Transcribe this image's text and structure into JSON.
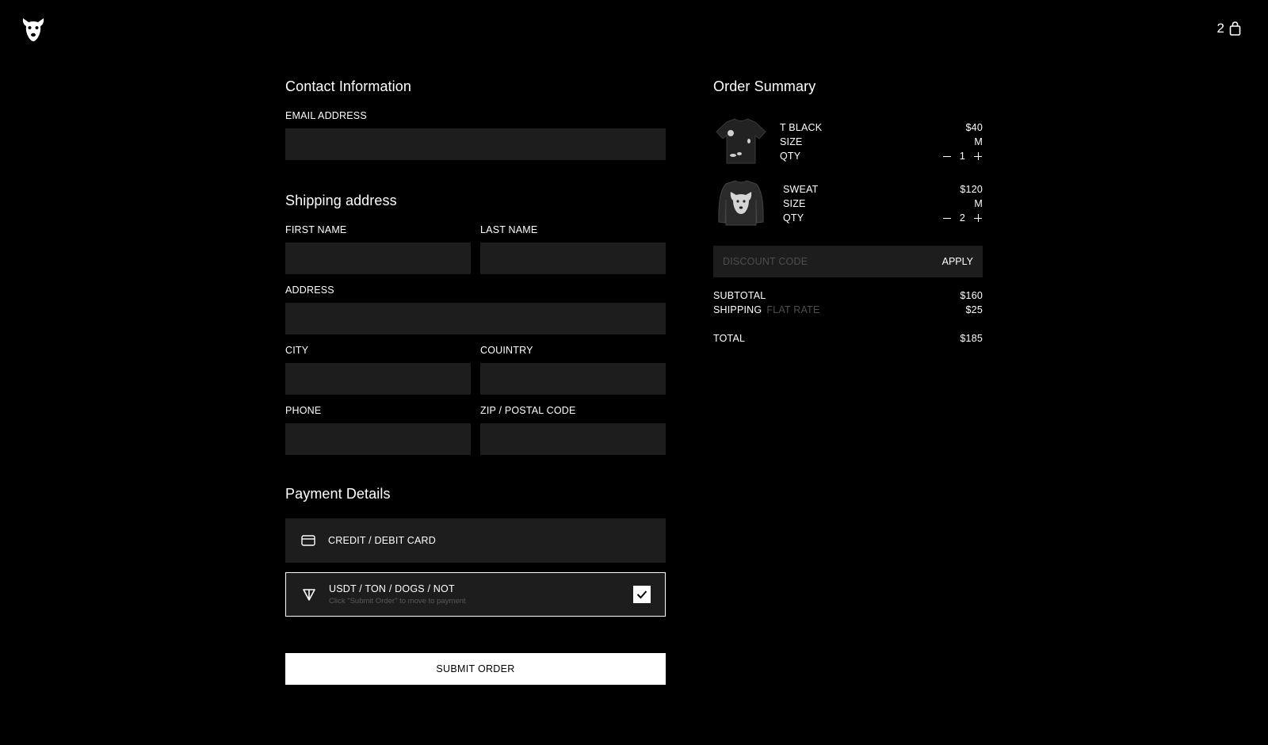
{
  "header": {
    "cart_count": "2"
  },
  "contact": {
    "title": "Contact Information",
    "email_label": "EMAIL ADDRESS"
  },
  "shipping": {
    "title": "Shipping address",
    "first_name_label": "FIRST NAME",
    "last_name_label": "LAST NAME",
    "address_label": "ADDRESS",
    "city_label": "CITY",
    "country_label": "COUINTRY",
    "phone_label": "PHONE",
    "zip_label": "ZIP / POSTAL CODE"
  },
  "payment": {
    "title": "Payment Details",
    "card_label": "CREDIT / DEBIT CARD",
    "crypto_label": "USDT / TON / DOGS / NOT",
    "crypto_hint": "Click \"Submit Order\" to move to payment",
    "submit_label": "SUBMIT ORDER"
  },
  "summary": {
    "title": "Order Summary",
    "items": [
      {
        "name": "T BLACK",
        "price": "$40",
        "size_label": "SIZE",
        "size": "M",
        "qty_label": "QTY",
        "qty": "1"
      },
      {
        "name": "SWEAT",
        "price": "$120",
        "size_label": "SIZE",
        "size": "M",
        "qty_label": "QTY",
        "qty": "2"
      }
    ],
    "discount_placeholder": "DISCOUNT CODE",
    "apply_label": "APPLY",
    "subtotal_label": "SUBTOTAL",
    "subtotal": "$160",
    "shipping_label": "SHIPPING",
    "shipping_method": "FLAT RATE",
    "shipping": "$25",
    "total_label": "TOTAL",
    "total": "$185"
  }
}
